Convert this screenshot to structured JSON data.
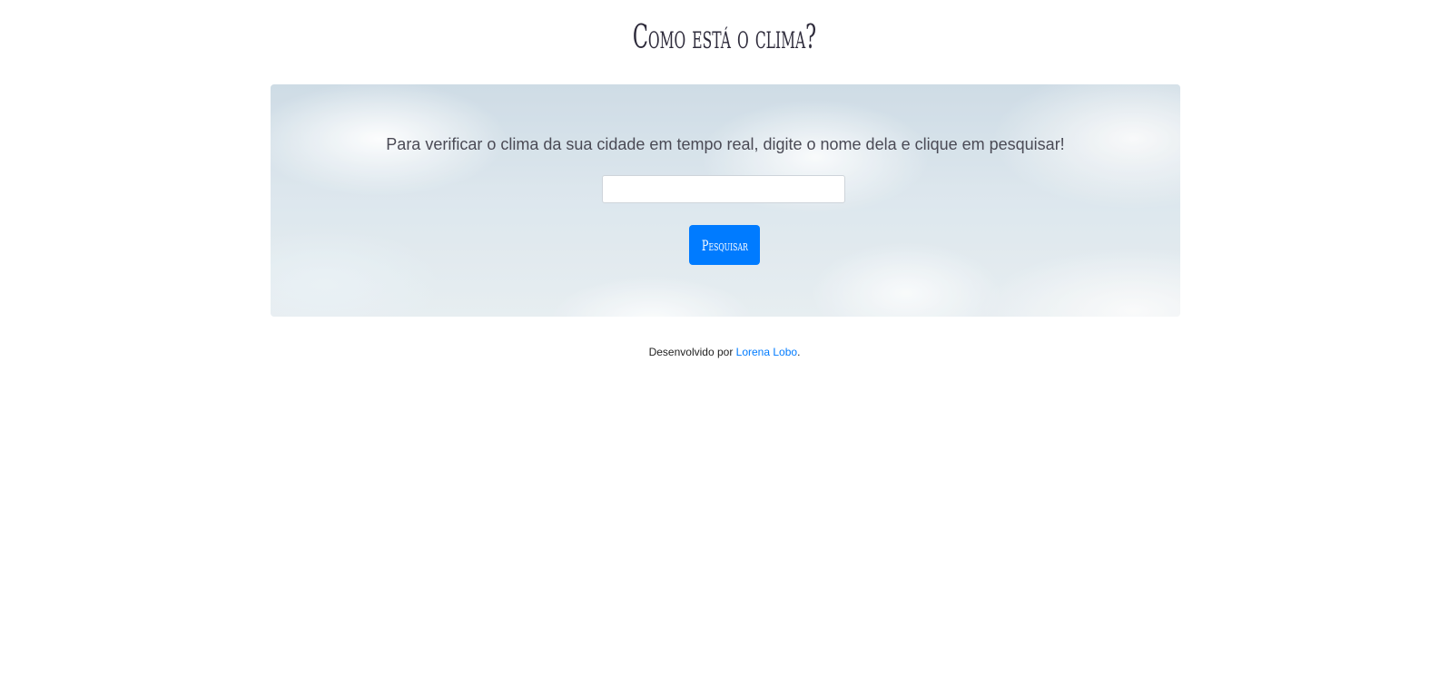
{
  "header": {
    "title": "Como está o clima?"
  },
  "search": {
    "instructions": "Para verificar o clima da sua cidade em tempo real, digite o nome dela e clique em pesquisar!",
    "input_value": "",
    "button_label": "Pesquisar"
  },
  "footer": {
    "prefix": "Desenvolvido por ",
    "author_link": "Lorena Lobo",
    "suffix": "."
  },
  "colors": {
    "accent": "#007bff",
    "title_text": "#2e2b3b"
  }
}
